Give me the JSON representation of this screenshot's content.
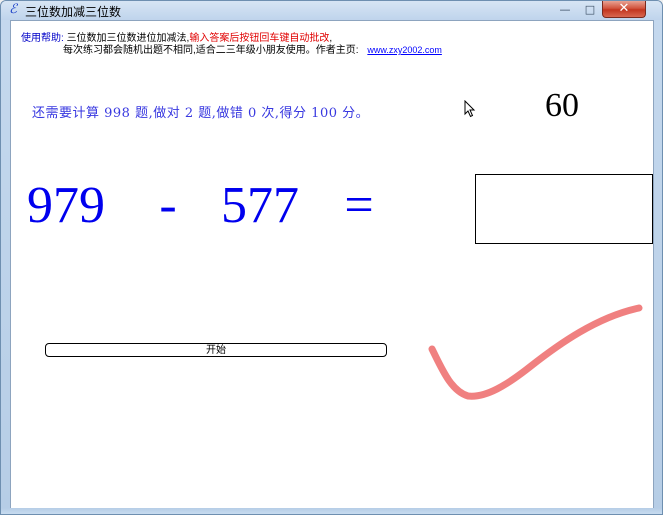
{
  "window": {
    "title": "三位数加减三位数",
    "app_icon": "app-icon",
    "minimize_icon": "minimize-icon",
    "maximize_icon": "maximize-icon",
    "close_icon": "close-icon",
    "controls": {
      "minimize": "—",
      "maximize": "□",
      "close": "✕"
    }
  },
  "help": {
    "label": "使用帮助:",
    "text_1": "三位数加三位数进位加减法,",
    "text_red": "输入答案后按钮回车键自动批改",
    "text_1_end": ",",
    "text_2": "每次练习都会随机出题不相同,适合二三年级小朋友使用。作者主页:",
    "link": "www.zxy2002.com"
  },
  "status": {
    "text": "还需要计算 998 题,做对 2 题,做错 0 次,得分 100 分。"
  },
  "timer": "60",
  "question": {
    "a": "979",
    "op": "-",
    "b": "577",
    "eq": "="
  },
  "answer": {
    "value": ""
  },
  "start_button": {
    "label": "开始"
  },
  "feedback": {
    "icon": "checkmark-icon",
    "color": "#f08080"
  }
}
